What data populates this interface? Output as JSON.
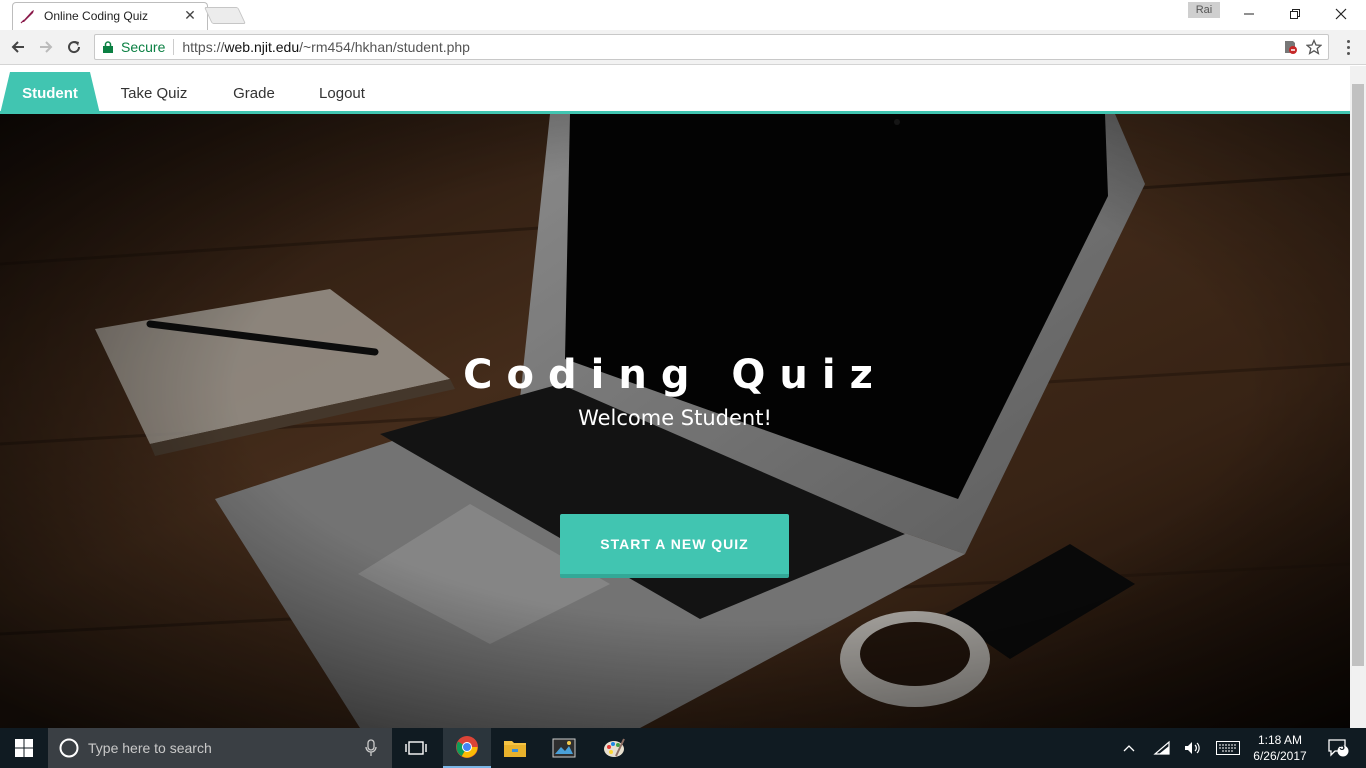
{
  "browser": {
    "tab_title": "Online Coding Quiz",
    "user_badge": "Rai",
    "secure_label": "Secure",
    "url_scheme": "https://",
    "url_host": "web.njit.edu",
    "url_path": "/~rm454/hkhan/student.php"
  },
  "nav": {
    "items": [
      {
        "label": "Student",
        "active": true
      },
      {
        "label": "Take Quiz",
        "active": false
      },
      {
        "label": "Grade",
        "active": false
      },
      {
        "label": "Logout",
        "active": false
      }
    ]
  },
  "hero": {
    "title": "Coding Quiz",
    "subtitle": "Welcome Student!",
    "button_label": "START A NEW QUIZ"
  },
  "taskbar": {
    "search_placeholder": "Type here to search",
    "time": "1:18 AM",
    "date": "6/26/2017",
    "notification_count": "5"
  },
  "colors": {
    "accent": "#41c5b1"
  }
}
